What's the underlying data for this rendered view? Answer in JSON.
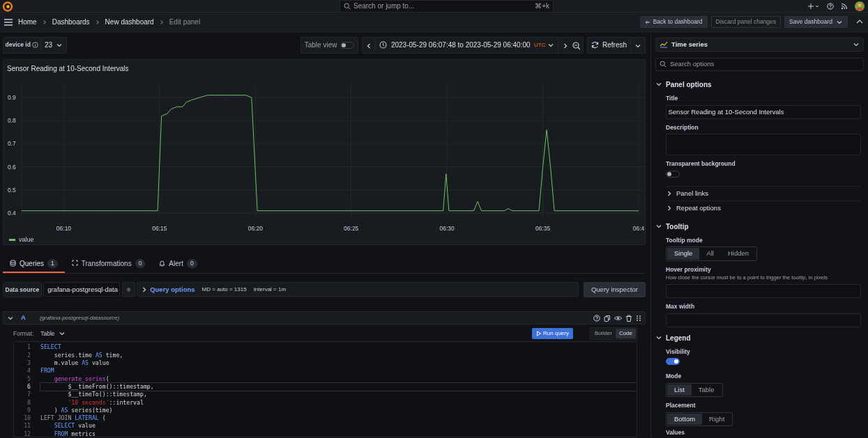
{
  "topbar": {
    "search": {
      "placeholder": "Search or jump to...",
      "shortcut": "⌘+k"
    }
  },
  "breadcrumbs": [
    {
      "label": "Home",
      "current": false
    },
    {
      "label": "Dashboards",
      "current": false
    },
    {
      "label": "New dashboard",
      "current": false
    },
    {
      "label": "Edit panel",
      "current": true
    }
  ],
  "actions": [
    {
      "label": "Back to dashboard",
      "kind": "back"
    },
    {
      "label": "Discard panel changes",
      "kind": "ghost"
    },
    {
      "label": "Save dashboard",
      "kind": "split"
    }
  ],
  "toolbar": {
    "variable": {
      "label": "device id",
      "value": "23"
    },
    "table_view": {
      "label": "Table view",
      "on": false
    },
    "time_range": {
      "text": "2023-05-29 06:07:48 to 2023-05-29 06:40:00",
      "timezone": "UTC"
    },
    "refresh": "Refresh"
  },
  "panel": {
    "title": "Sensor Reading at 10-Second Intervals",
    "chart_data": {
      "type": "line",
      "grid": true,
      "xlim": [
        367.8,
        400
      ],
      "ylim": [
        0.38,
        0.96
      ],
      "xticks": [
        {
          "value": 370,
          "label": "06:10"
        },
        {
          "value": 375,
          "label": "06:15"
        },
        {
          "value": 380,
          "label": "06:20"
        },
        {
          "value": 385,
          "label": "06:25"
        },
        {
          "value": 390,
          "label": "06:30"
        },
        {
          "value": 395,
          "label": "06:35"
        },
        {
          "value": 400,
          "label": "06:4"
        }
      ],
      "yticks": [
        0.4,
        0.5,
        0.6,
        0.7,
        0.8,
        0.9
      ],
      "x": [
        367.8,
        369,
        372,
        374.4,
        374.9,
        375.1,
        375.4,
        375.6,
        375.9,
        376.2,
        376.4,
        376.7,
        377.5,
        378.5,
        379.5,
        379.8,
        380.1,
        385,
        389.8,
        389.95,
        390.1,
        391.4,
        391.6,
        391.8,
        393,
        393.2,
        393.4,
        394.8,
        395,
        395.2,
        395.4,
        395.6,
        400
      ],
      "series": [
        {
          "name": "value",
          "color": "#73bf69",
          "values": [
            0.41,
            0.41,
            0.41,
            0.41,
            0.41,
            0.82,
            0.83,
            0.85,
            0.86,
            0.86,
            0.88,
            0.89,
            0.91,
            0.91,
            0.91,
            0.9,
            0.41,
            0.41,
            0.41,
            0.57,
            0.41,
            0.41,
            0.45,
            0.41,
            0.41,
            0.42,
            0.41,
            0.41,
            0.6,
            0.76,
            0.6,
            0.41,
            0.41
          ]
        }
      ]
    }
  },
  "query_tabs": [
    {
      "label": "Queries",
      "count": "1",
      "selected": true,
      "kind": "db"
    },
    {
      "label": "Transformations",
      "count": "0",
      "selected": false,
      "kind": "transform"
    },
    {
      "label": "Alert",
      "count": "0",
      "selected": false,
      "kind": "bell"
    }
  ],
  "datasource": {
    "label": "Data source",
    "value": "grafana-postgresql-data",
    "query_options": "Query options",
    "md": "MD = auto = 1315",
    "interval": "Interval = 1m",
    "inspector": "Query inspector"
  },
  "query": {
    "ref": "A",
    "source": "(grafana-postgresql-datasource)",
    "format_label": "Format:",
    "format": "Table",
    "run": "Run query",
    "modes": [
      {
        "label": "Builder",
        "selected": false
      },
      {
        "label": "Code",
        "selected": true
      }
    ],
    "lines": [
      {
        "n": "1",
        "current": false,
        "tokens": [
          {
            "text": "SELECT",
            "kind": "keyword"
          }
        ]
      },
      {
        "n": "2",
        "current": false,
        "tokens": [
          {
            "text": "    series.time ",
            "kind": "identifier"
          },
          {
            "text": "AS",
            "kind": "keyword"
          },
          {
            "text": " time,",
            "kind": "identifier"
          }
        ]
      },
      {
        "n": "3",
        "current": false,
        "tokens": [
          {
            "text": "    m.value ",
            "kind": "identifier"
          },
          {
            "text": "AS",
            "kind": "keyword"
          },
          {
            "text": " value",
            "kind": "identifier"
          }
        ]
      },
      {
        "n": "4",
        "current": false,
        "tokens": [
          {
            "text": "FROM",
            "kind": "keyword"
          }
        ]
      },
      {
        "n": "5",
        "current": false,
        "tokens": [
          {
            "text": "    generate_series",
            "kind": "function"
          },
          {
            "text": "(",
            "kind": "identifier"
          }
        ]
      },
      {
        "n": "6",
        "current": true,
        "tokens": [
          {
            "text": "        $__timeFrom()::timestamp,",
            "kind": "identifier"
          }
        ]
      },
      {
        "n": "7",
        "current": false,
        "tokens": [
          {
            "text": "        $__timeTo()::timestamp,",
            "kind": "identifier"
          }
        ]
      },
      {
        "n": "8",
        "current": false,
        "tokens": [
          {
            "text": "        '10 seconds'",
            "kind": "string"
          },
          {
            "text": "::interval",
            "kind": "identifier"
          }
        ]
      },
      {
        "n": "9",
        "current": false,
        "tokens": [
          {
            "text": "    ) ",
            "kind": "identifier"
          },
          {
            "text": "AS",
            "kind": "keyword"
          },
          {
            "text": " series(time)",
            "kind": "identifier"
          }
        ]
      },
      {
        "n": "10",
        "current": false,
        "tokens": [
          {
            "text": "LEFT JOIN ",
            "kind": "plain"
          },
          {
            "text": "LATERAL",
            "kind": "keyword"
          },
          {
            "text": " (",
            "kind": "identifier"
          }
        ]
      },
      {
        "n": "11",
        "current": false,
        "tokens": [
          {
            "text": "    SELECT",
            "kind": "keyword"
          },
          {
            "text": " value",
            "kind": "identifier"
          }
        ]
      },
      {
        "n": "12",
        "current": false,
        "tokens": [
          {
            "text": "    FROM",
            "kind": "keyword"
          },
          {
            "text": " metrics",
            "kind": "identifier"
          }
        ]
      }
    ]
  },
  "options": {
    "visualization": "Time series",
    "search": {
      "placeholder": "Search options"
    },
    "sections": [
      {
        "title": "Panel options",
        "expanded": true,
        "items": [
          {
            "kind": "input",
            "label": "Title",
            "value": "Sensor Reading at 10-Second Intervals"
          },
          {
            "kind": "textarea",
            "label": "Description"
          },
          {
            "kind": "switch",
            "label": "Transparent background",
            "on": false
          },
          {
            "kind": "group",
            "label": "Panel links",
            "expanded": false
          },
          {
            "kind": "group",
            "label": "Repeat options",
            "expanded": false
          }
        ]
      },
      {
        "title": "Tooltip",
        "expanded": true,
        "items": [
          {
            "kind": "radio",
            "label": "Tooltip mode",
            "options": [
              {
                "label": "Single",
                "selected": true
              },
              {
                "label": "All",
                "selected": false
              },
              {
                "label": "Hidden",
                "selected": false
              }
            ]
          },
          {
            "kind": "input",
            "label": "Hover proximity",
            "hint": "How close the cursor must be to a point to trigger the tooltip, in pixels"
          },
          {
            "kind": "input",
            "label": "Max width"
          }
        ]
      },
      {
        "title": "Legend",
        "expanded": true,
        "items": [
          {
            "kind": "switch",
            "label": "Visibility",
            "on": true
          },
          {
            "kind": "radio",
            "label": "Mode",
            "options": [
              {
                "label": "List",
                "selected": true
              },
              {
                "label": "Table",
                "selected": false
              }
            ]
          },
          {
            "kind": "radio",
            "label": "Placement",
            "options": [
              {
                "label": "Bottom",
                "selected": true
              },
              {
                "label": "Right",
                "selected": false
              }
            ]
          },
          {
            "kind": "label",
            "label": "Values"
          }
        ]
      }
    ]
  }
}
